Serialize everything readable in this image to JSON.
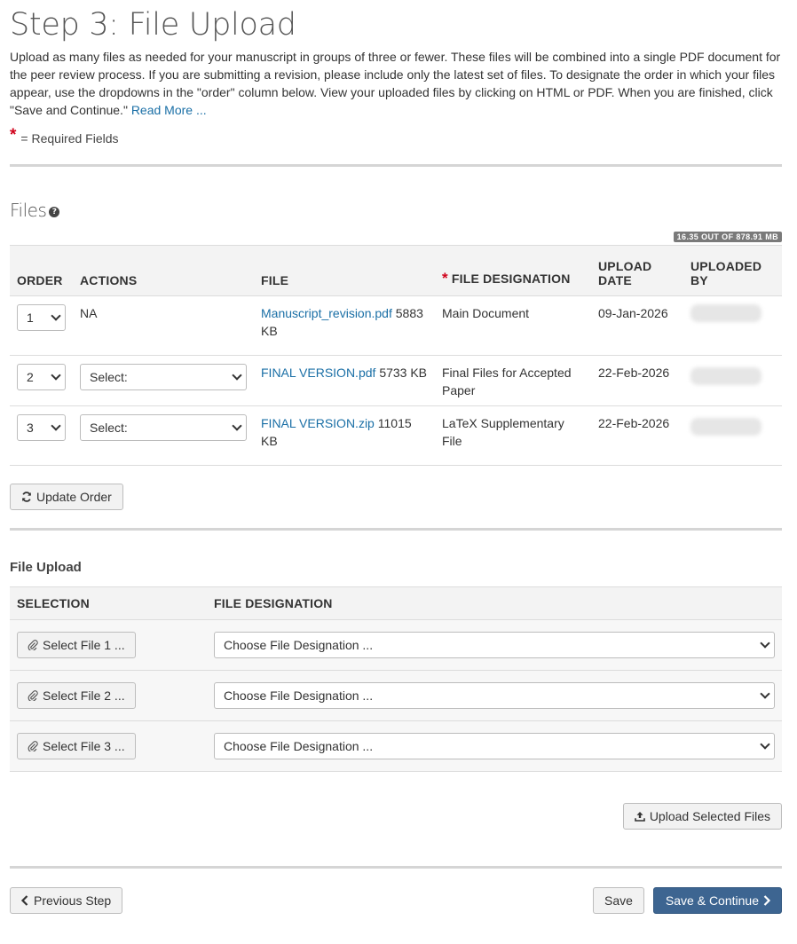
{
  "page": {
    "title": "Step 3: File Upload",
    "intro": "Upload as many files as needed for your manuscript in groups of three or fewer. These files will be combined into a single PDF document for the peer review process. If you are submitting a revision, please include only the latest set of files. To designate the order in which your files appear, use the dropdowns in the \"order\" column below. View your uploaded files by clicking on HTML or PDF. When you are finished, click \"Save and Continue.\"",
    "read_more": "Read More ...",
    "required_star": "*",
    "required_label": "= Required Fields"
  },
  "files": {
    "heading": "Files",
    "help_icon": "?",
    "quota": "16.35 OUT OF 878.91 MB",
    "headers": {
      "order": "ORDER",
      "actions": "ACTIONS",
      "file": "FILE",
      "designation_star": "*",
      "designation": "FILE DESIGNATION",
      "upload_date": "UPLOAD DATE",
      "uploaded_by": "UPLOADED BY"
    },
    "rows": [
      {
        "order": "1",
        "action": "NA",
        "file_name": "Manuscript_revision.pdf",
        "file_size": "5883 KB",
        "designation": "Main Document",
        "date": "09-Jan-2026"
      },
      {
        "order": "2",
        "action": "Select:",
        "file_name": "FINAL VERSION.pdf",
        "file_size": "5733 KB",
        "designation": "Final Files for Accepted Paper",
        "date": "22-Feb-2026"
      },
      {
        "order": "3",
        "action": "Select:",
        "file_name": "FINAL VERSION.zip",
        "file_size": "11015 KB",
        "designation": "LaTeX Supplementary File",
        "date": "22-Feb-2026"
      }
    ],
    "update_order_label": "Update Order"
  },
  "upload": {
    "title": "File Upload",
    "headers": {
      "selection": "SELECTION",
      "designation": "FILE DESIGNATION"
    },
    "rows": [
      {
        "select_label": "Select File 1 ...",
        "designation_placeholder": "Choose File Designation ..."
      },
      {
        "select_label": "Select File 2 ...",
        "designation_placeholder": "Choose File Designation ..."
      },
      {
        "select_label": "Select File 3 ...",
        "designation_placeholder": "Choose File Designation ..."
      }
    ],
    "upload_button": "Upload Selected Files"
  },
  "nav": {
    "previous": "Previous Step",
    "save": "Save",
    "save_continue": "Save & Continue"
  },
  "colors": {
    "link": "#1a6fa6",
    "primary": "#3d6591",
    "required": "#d0021b"
  }
}
